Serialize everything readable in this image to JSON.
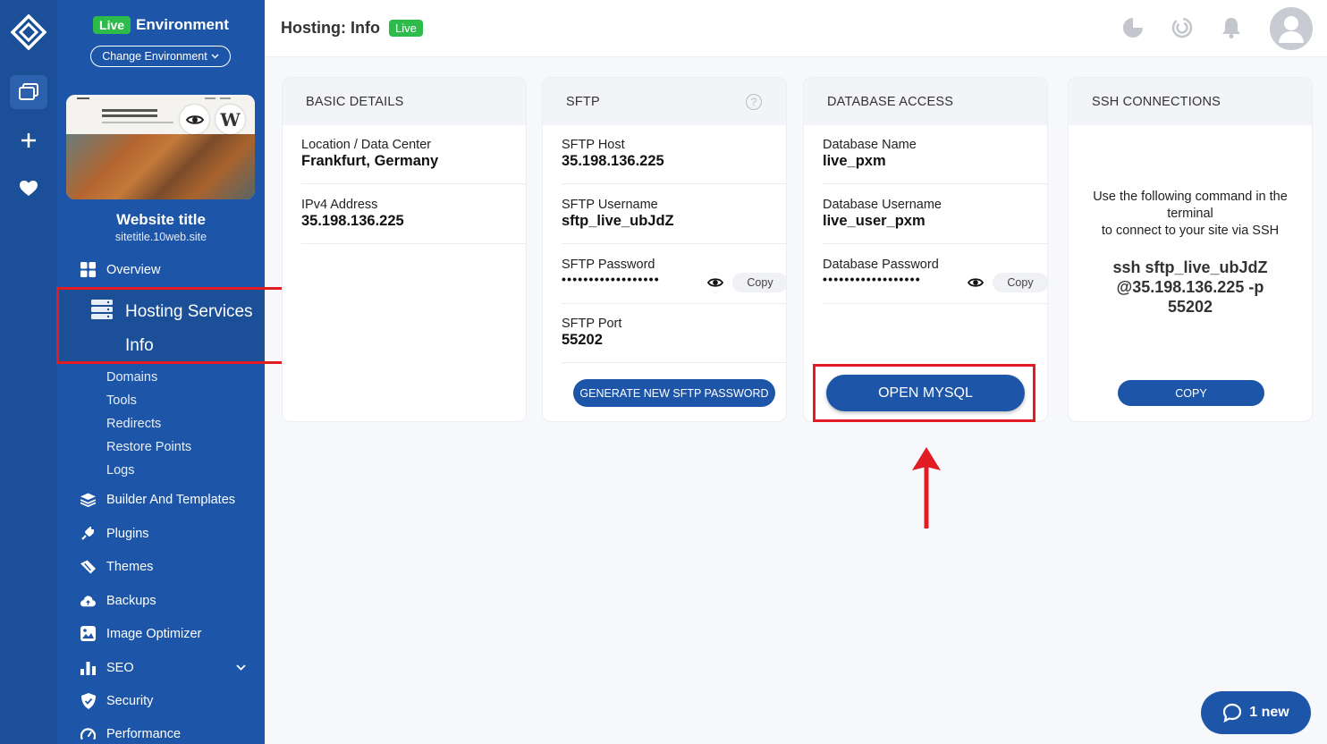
{
  "environment": {
    "badge": "Live",
    "label": "Environment",
    "change_label": "Change Environment"
  },
  "website": {
    "title": "Website title",
    "url": "sitetitle.10web.site"
  },
  "nav": {
    "overview": "Overview",
    "hosting": "Hosting Services",
    "hosting_sub": [
      "Info",
      "Domains",
      "Tools",
      "Redirects",
      "Restore Points",
      "Logs"
    ],
    "builder": "Builder And Templates",
    "plugins": "Plugins",
    "themes": "Themes",
    "backups": "Backups",
    "image_optimizer": "Image Optimizer",
    "seo": "SEO",
    "security": "Security",
    "performance": "Performance"
  },
  "header": {
    "title": "Hosting: Info",
    "badge": "Live"
  },
  "basic": {
    "title": "BASIC DETAILS",
    "location_label": "Location / Data Center",
    "location_value": "Frankfurt, Germany",
    "ipv4_label": "IPv4 Address",
    "ipv4_value": "35.198.136.225"
  },
  "sftp": {
    "title": "SFTP",
    "host_label": "SFTP Host",
    "host_value": "35.198.136.225",
    "user_label": "SFTP Username",
    "user_value": "sftp_live_ubJdZ",
    "pass_label": "SFTP Password",
    "pass_value": "••••••••••••••••••",
    "copy_label": "Copy",
    "port_label": "SFTP Port",
    "port_value": "55202",
    "generate_label": "GENERATE NEW SFTP PASSWORD"
  },
  "db": {
    "title": "DATABASE ACCESS",
    "name_label": "Database Name",
    "name_value": "live_pxm",
    "user_label": "Database Username",
    "user_value": "live_user_pxm",
    "pass_label": "Database Password",
    "pass_value": "••••••••••••••••••",
    "copy_label": "Copy",
    "open_label": "OPEN MYSQL"
  },
  "ssh": {
    "title": "SSH CONNECTIONS",
    "hint1": "Use the following command in the terminal",
    "hint2": "to connect to your site via SSH",
    "cmd1": "ssh sftp_live_ubJdZ",
    "cmd2": "@35.198.136.225 -p",
    "cmd3": "55202",
    "copy_label": "COPY"
  },
  "chat": {
    "label": "1 new"
  },
  "colors": {
    "primary": "#1d56a8",
    "live": "#2dbb4c",
    "annotation": "#e31b23"
  }
}
